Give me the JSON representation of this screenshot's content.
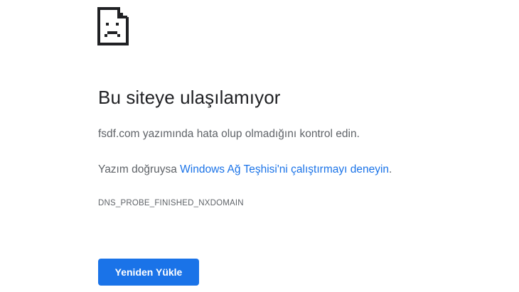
{
  "error": {
    "icon": "sad-page-icon",
    "title": "Bu siteye ulaşılamıyor",
    "message_line1": "fsdf.com yazımında hata olup olmadığını kontrol edin.",
    "message_line2_prefix": "Yazım doğruysa ",
    "message_line2_link": "Windows Ağ Teşhisi'ni çalıştırmayı deneyin",
    "message_line2_suffix": ".",
    "error_code": "DNS_PROBE_FINISHED_NXDOMAIN",
    "reload_button_label": "Yeniden Yükle"
  },
  "colors": {
    "title": "#202124",
    "body_text": "#5f6368",
    "link": "#1a73e8",
    "button_bg": "#1a73e8",
    "button_text": "#ffffff",
    "background": "#ffffff"
  }
}
